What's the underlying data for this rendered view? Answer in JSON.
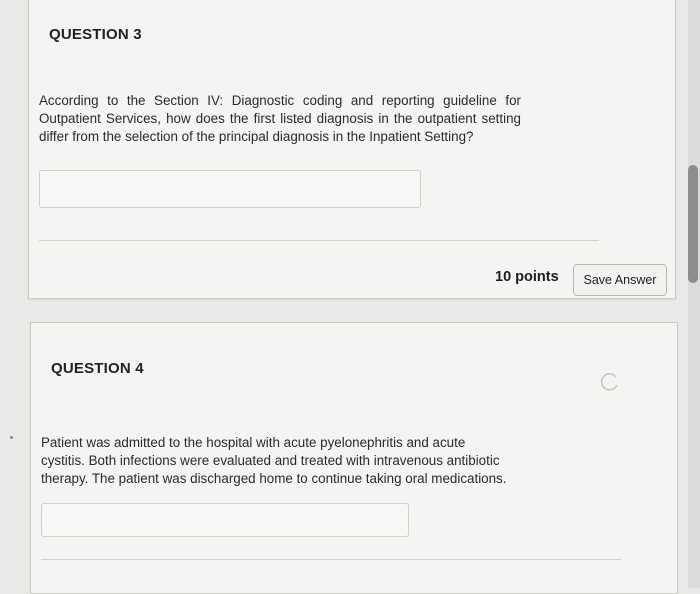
{
  "question3": {
    "title": "QUESTION 3",
    "text": "According to the Section IV: Diagnostic coding and reporting guideline for Outpatient Services, how does the first listed diagnosis in the outpatient setting differ from the selection of the principal diagnosis in the Inpatient Setting?",
    "answer_value": "",
    "points": "10 points",
    "save_label": "Save Answer"
  },
  "question4": {
    "title": "QUESTION 4",
    "text": "Patient was admitted to the hospital with acute pyelonephritis and acute cystitis. Both infections were evaluated and treated with intravenous antibiotic therapy. The patient was discharged home to continue taking oral medications.",
    "answer_value": ""
  },
  "icons": {
    "refresh": "refresh-icon"
  }
}
